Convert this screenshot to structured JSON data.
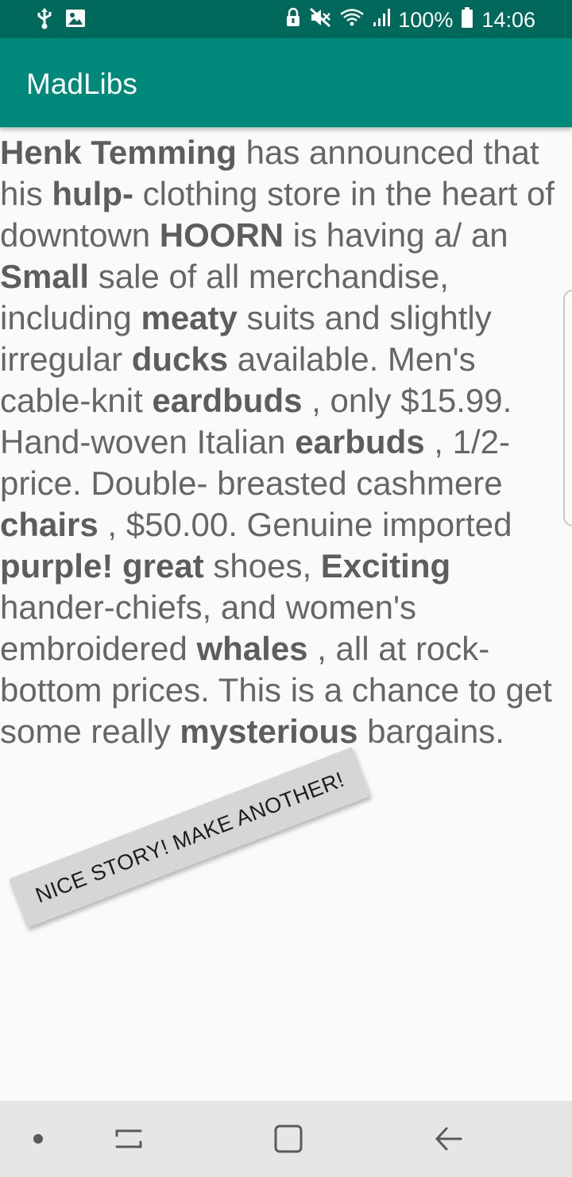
{
  "status_bar": {
    "battery": "100%",
    "time": "14:06",
    "left_icons": [
      "usb-icon",
      "image-icon"
    ],
    "right_icons": [
      "lock-icon",
      "mute-icon",
      "wifi-icon",
      "signal-icon",
      "battery-icon"
    ]
  },
  "app_bar": {
    "title": "MadLibs"
  },
  "story": [
    {
      "t": "Henk Temming",
      "b": true
    },
    {
      "t": " has announced that his ",
      "b": false
    },
    {
      "t": "hulp-",
      "b": true
    },
    {
      "t": " clothing store in the heart of downtown ",
      "b": false
    },
    {
      "t": "HOORN",
      "b": true
    },
    {
      "t": " is having a/ an ",
      "b": false
    },
    {
      "t": "Small",
      "b": true
    },
    {
      "t": " sale of all merchandise, including ",
      "b": false
    },
    {
      "t": "meaty",
      "b": true
    },
    {
      "t": " suits and slightly irregular ",
      "b": false
    },
    {
      "t": "ducks",
      "b": true
    },
    {
      "t": " available. Men's cable-knit ",
      "b": false
    },
    {
      "t": "eardbuds",
      "b": true
    },
    {
      "t": " , only $15.99. Hand-woven Italian ",
      "b": false
    },
    {
      "t": "earbuds",
      "b": true
    },
    {
      "t": " , 1/2-price. Double- breasted cashmere ",
      "b": false
    },
    {
      "t": "chairs",
      "b": true
    },
    {
      "t": " , $50.00. Genuine imported ",
      "b": false
    },
    {
      "t": "purple! great",
      "b": true
    },
    {
      "t": " shoes, ",
      "b": false
    },
    {
      "t": "Exciting",
      "b": true
    },
    {
      "t": " hander-chiefs, and women's embroidered ",
      "b": false
    },
    {
      "t": "whales",
      "b": true
    },
    {
      "t": " , all at rock-bottom prices. This is a chance to get some really ",
      "b": false
    },
    {
      "t": "mysterious",
      "b": true
    },
    {
      "t": " bargains.",
      "b": false
    }
  ],
  "action_button": {
    "label": "NICE STORY! MAKE ANOTHER!"
  },
  "nav_bar": {
    "items": [
      "dot-icon",
      "recent-apps-icon",
      "home-icon",
      "back-icon"
    ]
  }
}
